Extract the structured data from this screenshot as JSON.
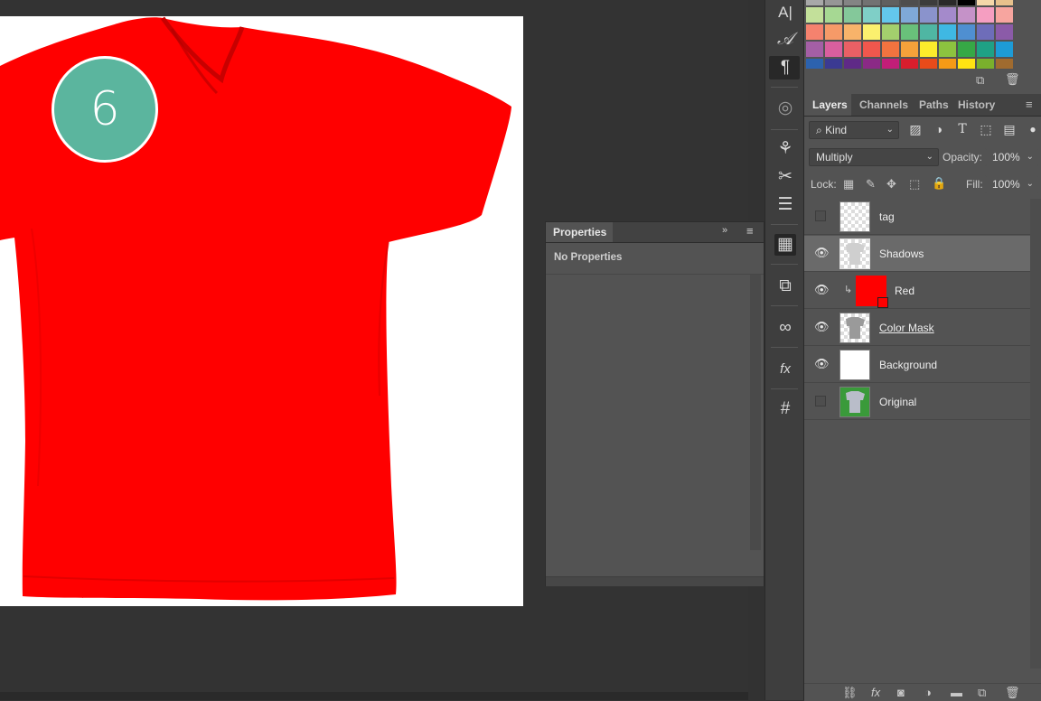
{
  "canvas": {
    "step_number": "6",
    "shirt_color": "#ff0000",
    "badge_color": "#5bb59e"
  },
  "properties": {
    "tab_label": "Properties",
    "empty_message": "No Properties",
    "collapse_glyph": "»",
    "menu_glyph": "≡"
  },
  "tools": [
    {
      "icon": "character-panel-icon",
      "glyph": "A|"
    },
    {
      "icon": "glyph-panel-icon",
      "glyph": "𝒜"
    },
    {
      "icon": "paragraph-panel-icon",
      "glyph": "¶"
    },
    {
      "icon": "3d-target-icon",
      "glyph": "◎"
    },
    {
      "icon": "brush-presets-icon",
      "glyph": "⚘"
    },
    {
      "icon": "tool-presets-icon",
      "glyph": "✂"
    },
    {
      "icon": "adjustments-icon",
      "glyph": "☰"
    },
    {
      "icon": "properties-panel-icon",
      "glyph": "▦"
    },
    {
      "icon": "clone-source-icon",
      "glyph": "⧉"
    },
    {
      "icon": "creative-cloud-icon",
      "glyph": "∞"
    },
    {
      "icon": "styles-fx-icon",
      "glyph": "fx"
    },
    {
      "icon": "grid-icon",
      "glyph": "#"
    }
  ],
  "swatches": {
    "rows": [
      [
        "#c3e09a",
        "#a6d893",
        "#84c89a",
        "#7fcfc7",
        "#63c7ec",
        "#7fa9d8",
        "#8a93cc",
        "#a48acb",
        "#c592c8",
        "#f59ec1",
        "#f7a59f"
      ],
      [
        "#f5826e",
        "#f69a68",
        "#f8b36a",
        "#fbf06e",
        "#a3cf6d",
        "#69c07a",
        "#4fb6a3",
        "#3fb8e3",
        "#4f8fd1",
        "#6e6db9",
        "#8b5ba8"
      ],
      [
        "#a45fa5",
        "#d95f9e",
        "#ea6065",
        "#f0574d",
        "#f2733f",
        "#f5a13a",
        "#fcec2b",
        "#8cc33f",
        "#36a846",
        "#1fa185",
        "#1d9bd6"
      ],
      [
        "#2c62ae",
        "#3b3a92",
        "#5f2a87",
        "#8b2a86",
        "#c21e78",
        "#d91e2d",
        "#e84b1a",
        "#f59a16",
        "#ffe312",
        "#7ab02c",
        "#a06b2f"
      ]
    ],
    "top_row": [
      "#a8a8a8",
      "#969696",
      "#848484",
      "#727272",
      "#606060",
      "#4e4e4e",
      "#3c3c3c",
      "#2a2a2a",
      "#000000",
      "#f5d7a9",
      "#e7c18c"
    ]
  },
  "layers_panel": {
    "tabs": [
      "Layers",
      "Channels",
      "Paths",
      "History"
    ],
    "filter_kind": "Kind",
    "blend_mode": "Multiply",
    "opacity_label": "Opacity:",
    "opacity_value": "100%",
    "lock_label": "Lock:",
    "fill_label": "Fill:",
    "fill_value": "100%",
    "layers": [
      {
        "name": "tag",
        "visible": false,
        "selected": false,
        "thumb": "transparent"
      },
      {
        "name": "Shadows",
        "visible": true,
        "selected": true,
        "thumb": "shadows"
      },
      {
        "name": "Red",
        "visible": true,
        "selected": false,
        "thumb": "red",
        "clipped": true
      },
      {
        "name": "Color Mask",
        "visible": true,
        "selected": false,
        "thumb": "mask"
      },
      {
        "name": "Background",
        "visible": true,
        "selected": false,
        "thumb": "white"
      },
      {
        "name": "Original",
        "visible": false,
        "selected": false,
        "thumb": "original"
      }
    ]
  }
}
